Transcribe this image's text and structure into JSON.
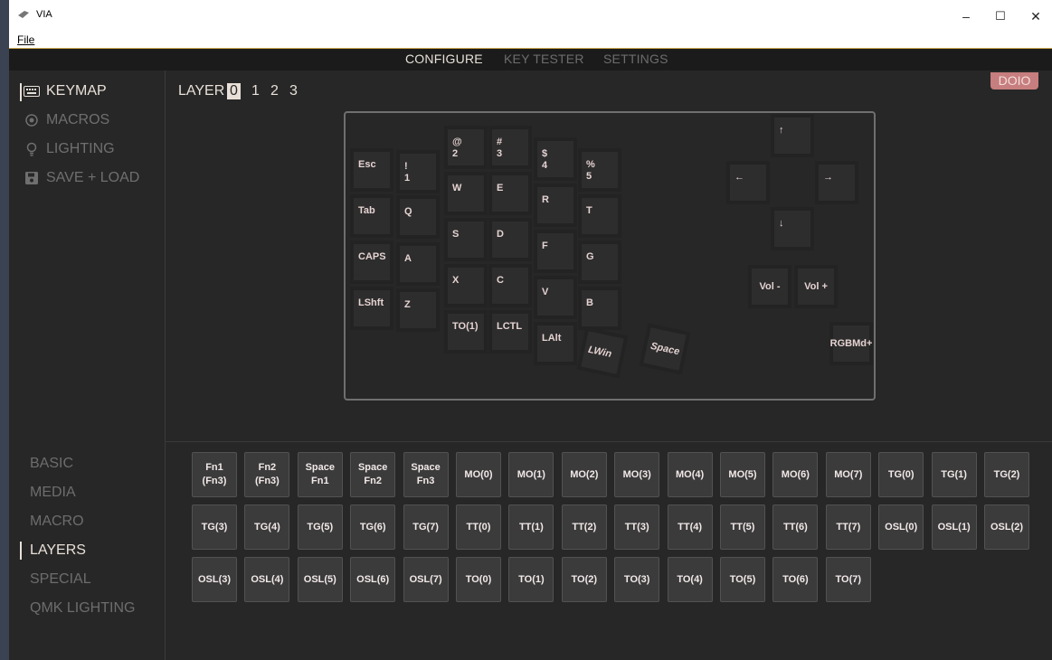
{
  "window": {
    "title": "VIA",
    "menu": "File",
    "minimize": "–",
    "maximize": "☐",
    "close": "✕"
  },
  "tabs": [
    "CONFIGURE",
    "KEY TESTER",
    "SETTINGS"
  ],
  "sidebar": {
    "items": [
      {
        "label": "KEYMAP",
        "icon": "keyboard-icon"
      },
      {
        "label": "MACROS",
        "icon": "record-icon"
      },
      {
        "label": "LIGHTING",
        "icon": "lightbulb-icon"
      },
      {
        "label": "SAVE + LOAD",
        "icon": "save-icon"
      }
    ]
  },
  "layer": {
    "label": "LAYER",
    "options": [
      "0",
      "1",
      "2",
      "3"
    ],
    "selected": "0"
  },
  "badge": "DOIO",
  "keyboard": {
    "keys": [
      "Esc",
      "!\n1",
      "@\n2",
      "#\n3",
      "$\n4",
      "%\n5",
      "Tab",
      "Q",
      "W",
      "E",
      "R",
      "T",
      "CAPS",
      "A",
      "S",
      "D",
      "F",
      "G",
      "LShft",
      "Z",
      "X",
      "C",
      "V",
      "B",
      "TO(1)",
      "LCTL",
      "LAlt",
      "LWin",
      "Space",
      "↑",
      "←",
      "→",
      "↓",
      "Vol -",
      "Vol +",
      "RGBMd+"
    ]
  },
  "categories": {
    "items": [
      "BASIC",
      "MEDIA",
      "MACRO",
      "LAYERS",
      "SPECIAL",
      "QMK LIGHTING"
    ],
    "active": "LAYERS"
  },
  "palette": {
    "rows": [
      [
        "Fn1\n(Fn3)",
        "Fn2\n(Fn3)",
        "Space\nFn1",
        "Space\nFn2",
        "Space\nFn3",
        "MO(0)",
        "MO(1)",
        "MO(2)",
        "MO(3)",
        "MO(4)",
        "MO(5)",
        "MO(6)",
        "MO(7)",
        "TG(0)",
        "TG(1)",
        "TG(2)"
      ],
      [
        "TG(3)",
        "TG(4)",
        "TG(5)",
        "TG(6)",
        "TG(7)",
        "TT(0)",
        "TT(1)",
        "TT(2)",
        "TT(3)",
        "TT(4)",
        "TT(5)",
        "TT(6)",
        "TT(7)",
        "OSL(0)",
        "OSL(1)",
        "OSL(2)"
      ],
      [
        "OSL(3)",
        "OSL(4)",
        "OSL(5)",
        "OSL(6)",
        "OSL(7)",
        "TO(0)",
        "TO(1)",
        "TO(2)",
        "TO(3)",
        "TO(4)",
        "TO(5)",
        "TO(6)",
        "TO(7)"
      ]
    ]
  }
}
